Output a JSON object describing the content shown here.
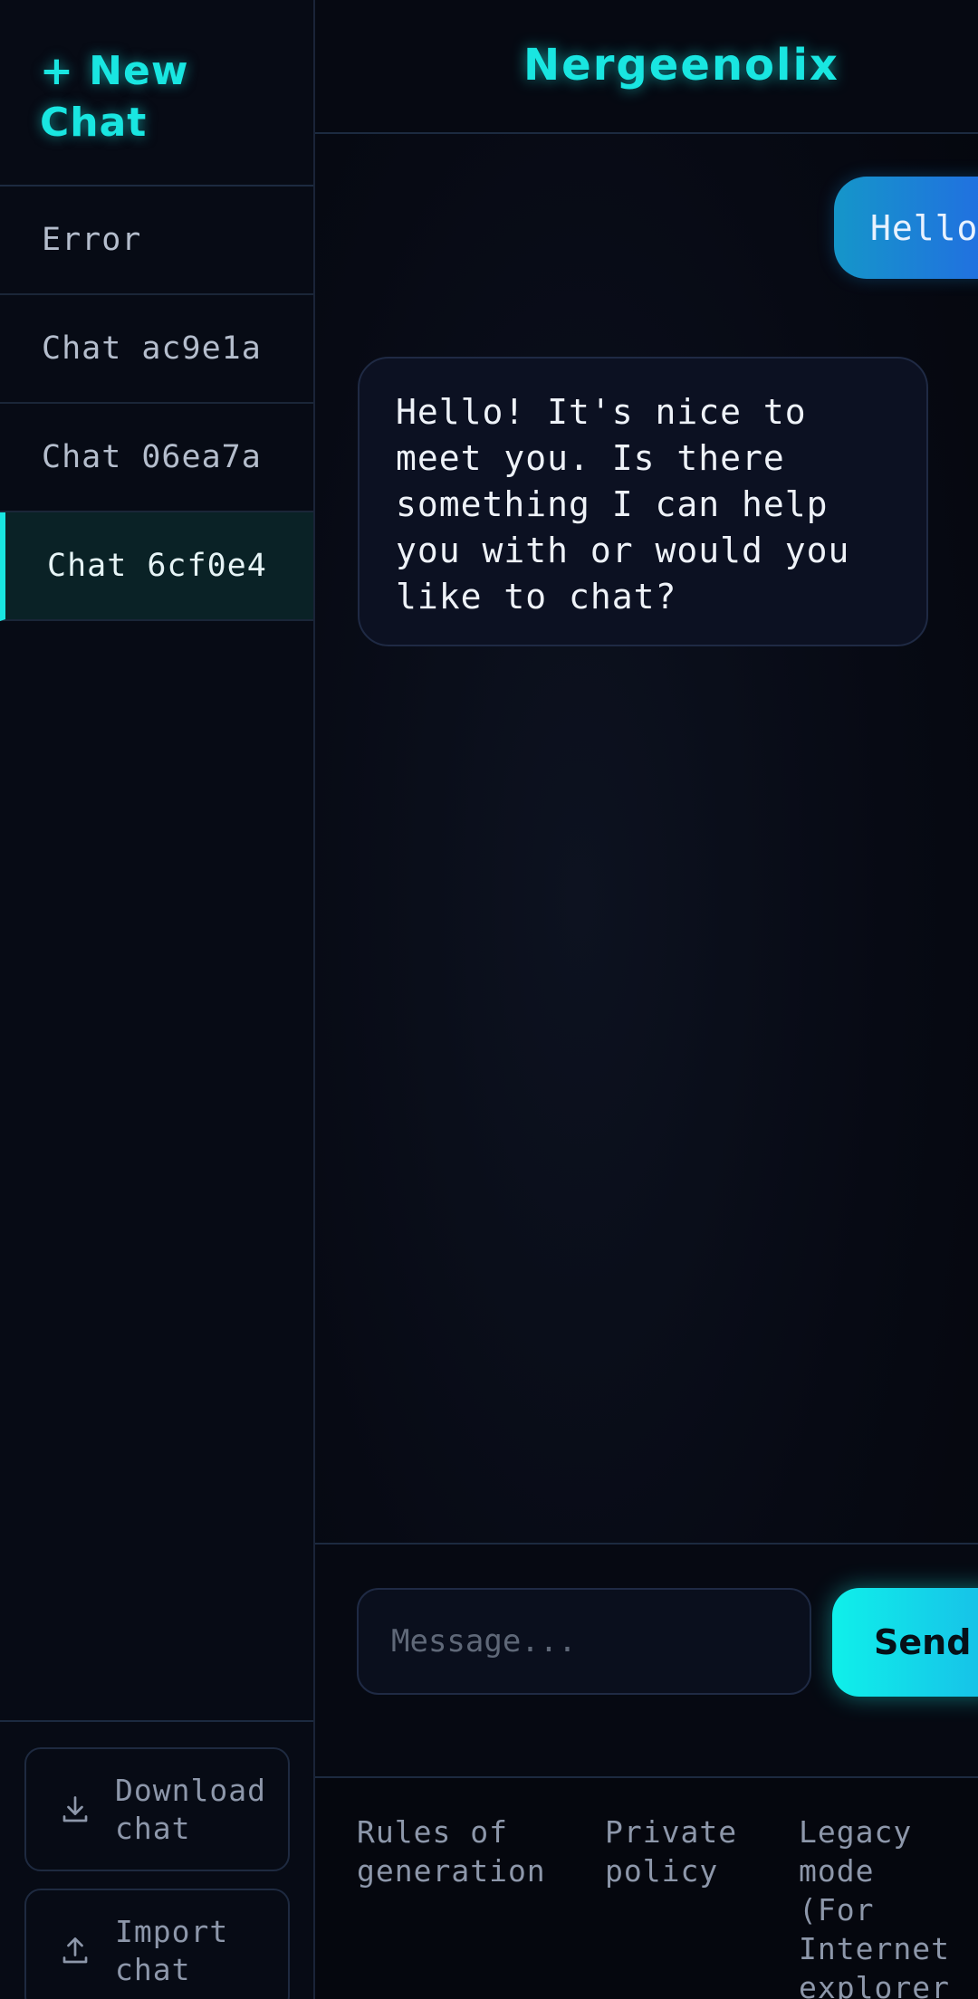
{
  "sidebar": {
    "new_chat_label": "+ New Chat",
    "chats": [
      {
        "label": "Error",
        "active": false
      },
      {
        "label": "Chat ac9e1a",
        "active": false
      },
      {
        "label": "Chat 06ea7a",
        "active": false
      },
      {
        "label": "Chat 6cf0e4",
        "active": true
      }
    ],
    "download_label": "Download chat",
    "import_label": "Import chat"
  },
  "header": {
    "title": "Nergeenolix"
  },
  "messages": [
    {
      "role": "user",
      "text": "Hello"
    },
    {
      "role": "assistant",
      "text": "Hello! It's nice to meet you. Is there something I can help you with or would you like to chat?"
    }
  ],
  "composer": {
    "placeholder": "Message...",
    "send_label": "Send"
  },
  "footer": {
    "links": [
      "Rules of generation",
      "Private policy",
      "Legacy mode\n(For Internet explorer users)"
    ]
  },
  "colors": {
    "accent": "#19e6e1",
    "user_bubble_start": "#1596c9",
    "user_bubble_end": "#2563e8",
    "background": "#050810"
  },
  "icons": {
    "download": "download-icon",
    "import": "upload-icon"
  }
}
